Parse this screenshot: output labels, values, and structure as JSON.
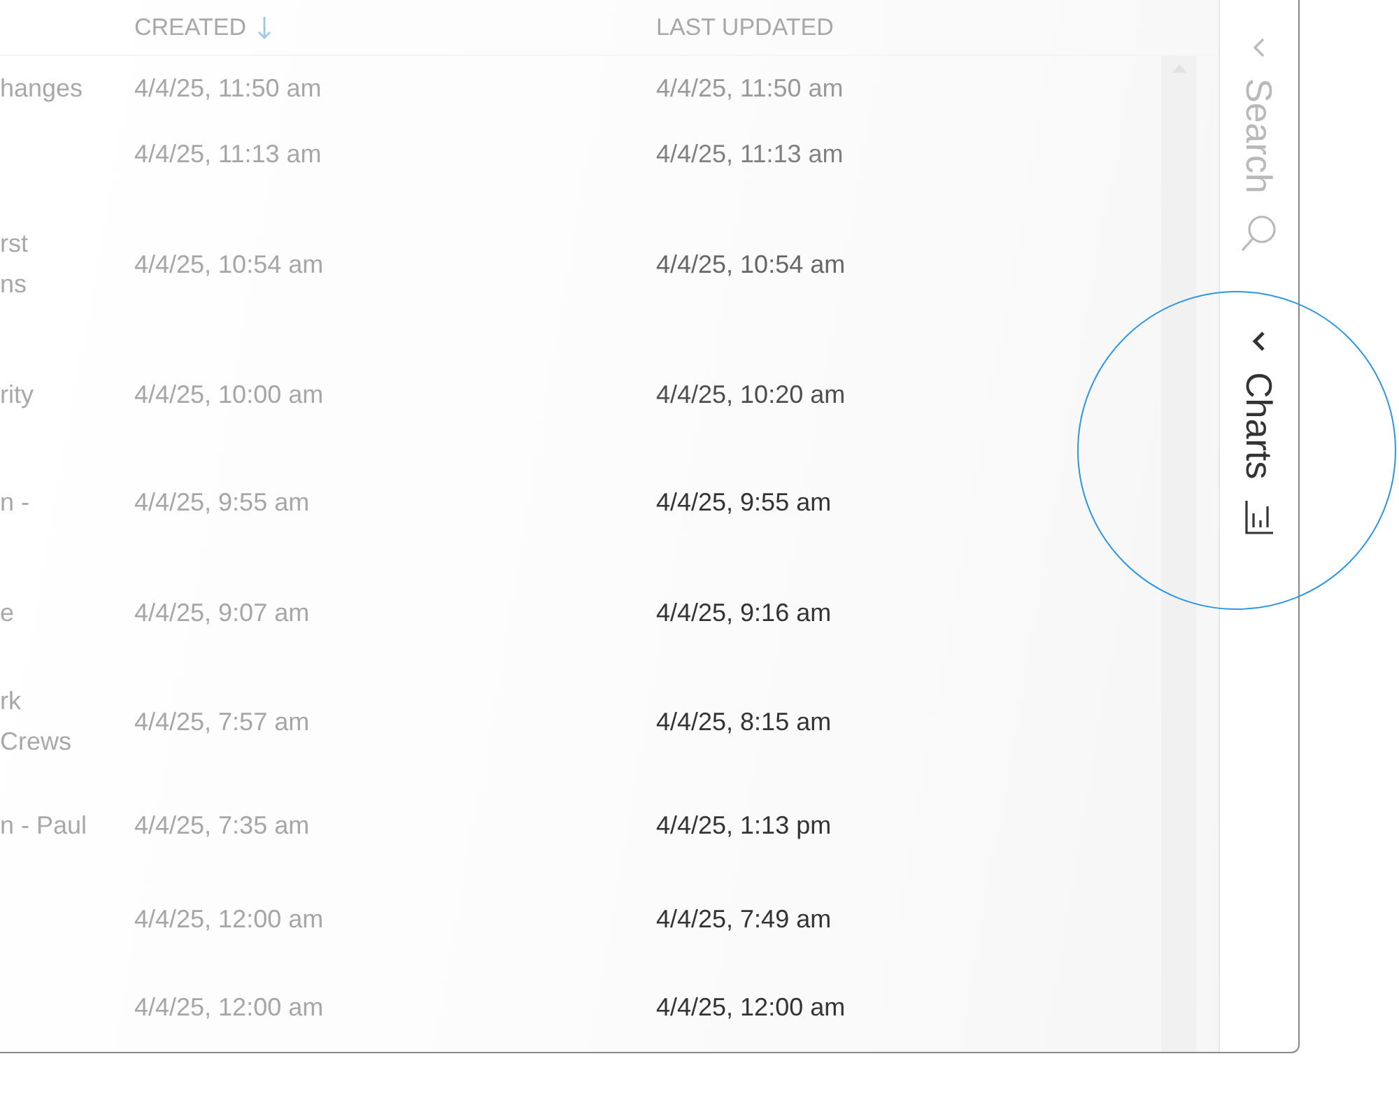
{
  "table": {
    "columns": [
      {
        "label": "CREATED",
        "sorted_descending": true
      },
      {
        "label": "LAST UPDATED"
      }
    ],
    "rows": [
      {
        "name": [
          "hanges"
        ],
        "created": "4/4/25, 11:50 am",
        "updated": "4/4/25, 11:50 am"
      },
      {
        "name": [],
        "created": "4/4/25, 11:13 am",
        "updated": "4/4/25, 11:13 am"
      },
      {
        "name": [
          "rst",
          "ns"
        ],
        "created": "4/4/25, 10:54 am",
        "updated": "4/4/25, 10:54 am"
      },
      {
        "name": [
          "rity"
        ],
        "created": "4/4/25, 10:00 am",
        "updated": "4/4/25, 10:20 am"
      },
      {
        "name": [
          "n -"
        ],
        "created": "4/4/25, 9:55 am",
        "updated": "4/4/25, 9:55 am"
      },
      {
        "name": [
          "e"
        ],
        "created": "4/4/25, 9:07 am",
        "updated": "4/4/25, 9:16 am"
      },
      {
        "name": [
          "rk",
          "Crews"
        ],
        "created": "4/4/25, 7:57 am",
        "updated": "4/4/25, 8:15 am"
      },
      {
        "name": [
          "n - Paul"
        ],
        "created": "4/4/25, 7:35 am",
        "updated": "4/4/25, 1:13 pm"
      },
      {
        "name": [],
        "created": "4/4/25, 12:00 am",
        "updated": "4/4/25, 7:49 am"
      },
      {
        "name": [],
        "created": "4/4/25, 12:00 am",
        "updated": "4/4/25, 12:00 am"
      }
    ]
  },
  "side_panel": {
    "tabs": [
      {
        "label": "Search",
        "kind": "search",
        "disabled": true,
        "highlighted": false
      },
      {
        "label": "Charts",
        "kind": "charts",
        "disabled": false,
        "highlighted": true
      }
    ]
  }
}
